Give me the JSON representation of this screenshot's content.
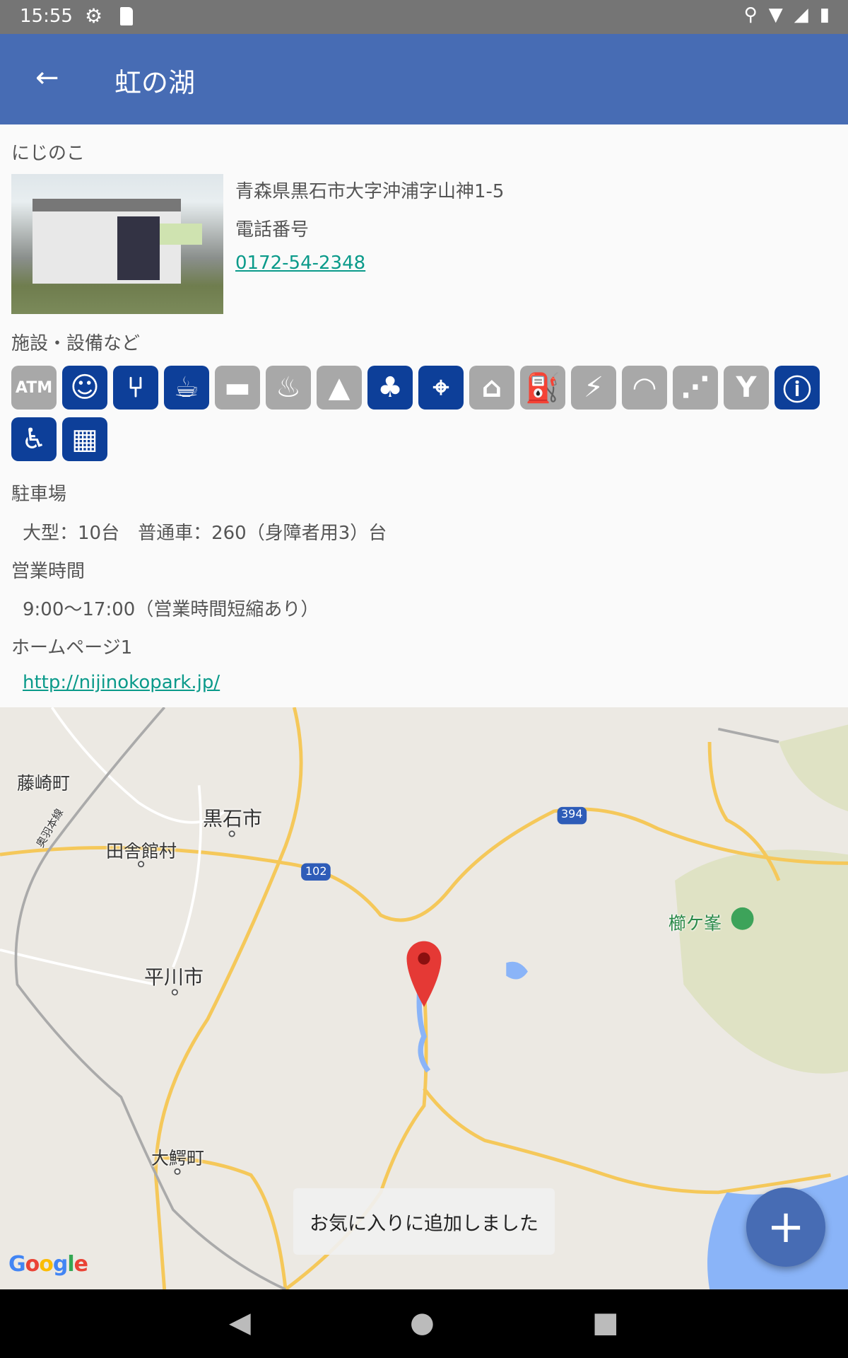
{
  "status": {
    "time": "15:55"
  },
  "toolbar": {
    "title": "虹の湖",
    "back_icon": "arrow-left-icon"
  },
  "facility": {
    "reading": "にじのこ",
    "address": "青森県黒石市大字沖浦字山神1-5",
    "phone_label": "電話番号",
    "phone": "0172-54-2348",
    "amenities_label": "施設・設備など",
    "amenities": [
      {
        "icon": "atm",
        "active": false
      },
      {
        "icon": "baby",
        "active": true
      },
      {
        "icon": "restaurant",
        "active": true
      },
      {
        "icon": "cafe",
        "active": true
      },
      {
        "icon": "bed",
        "active": false
      },
      {
        "icon": "hot-spring",
        "active": false
      },
      {
        "icon": "camping",
        "active": false
      },
      {
        "icon": "park",
        "active": true
      },
      {
        "icon": "telescope",
        "active": true
      },
      {
        "icon": "museum",
        "active": false
      },
      {
        "icon": "gas-station",
        "active": false
      },
      {
        "icon": "ev-charger",
        "active": false
      },
      {
        "icon": "wifi",
        "active": false
      },
      {
        "icon": "shower",
        "active": false
      },
      {
        "icon": "playground",
        "active": false
      },
      {
        "icon": "info",
        "active": true
      },
      {
        "icon": "wheelchair",
        "active": true
      },
      {
        "icon": "shop",
        "active": true
      }
    ],
    "parking_label": "駐車場",
    "parking": "大型：10台　普通車：260（身障者用3）台",
    "hours_label": "営業時間",
    "hours": "9:00〜17:00（営業時間短縮あり）",
    "homepage_label": "ホームページ1",
    "homepage": "http://nijinokopark.jp/"
  },
  "map": {
    "labels": {
      "fujisaki": "藤崎町",
      "kuroishi": "黒石市",
      "inakadate": "田舎館村",
      "hirakawa": "平川市",
      "owani": "大鰐町",
      "kushigamine": "櫛ケ峯",
      "ou_line": "奥羽本線",
      "route102": "102",
      "route394": "394"
    },
    "google": "Google"
  },
  "snackbar": "お気に入りに追加しました",
  "fab": "+",
  "colors": {
    "primary": "#476cb4",
    "active_icon": "#0d3f99",
    "inactive_icon": "#a8a8a8",
    "link": "#0a9a8a"
  }
}
